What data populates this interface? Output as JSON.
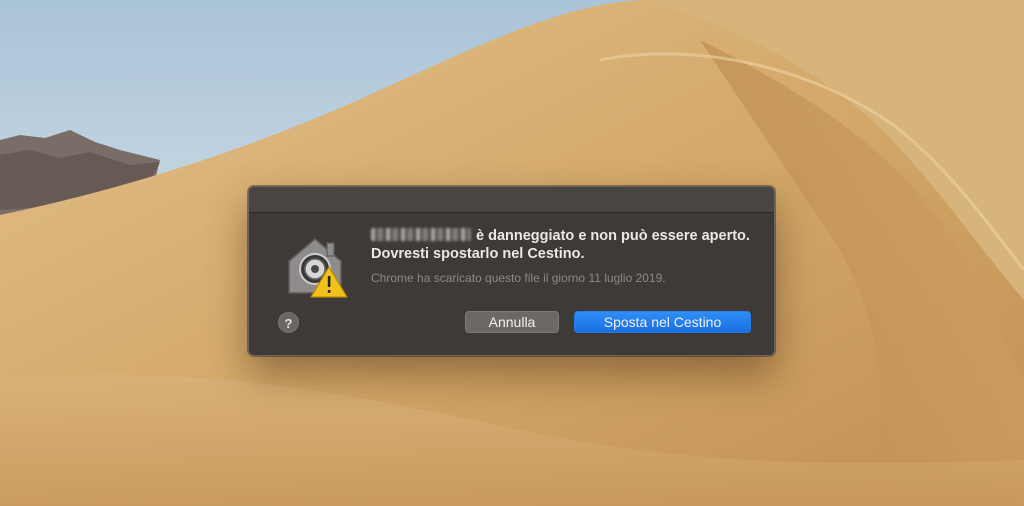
{
  "dialog": {
    "icon": "gatekeeper-warning-icon",
    "message_redacted_name": "",
    "message_text": "è danneggiato e non può essere aperto. Dovresti spostarlo nel Cestino.",
    "info_text": "Chrome ha scaricato questo file il giorno 11 luglio 2019.",
    "help_label": "?",
    "cancel_label": "Annulla",
    "move_to_trash_label": "Sposta nel Cestino"
  },
  "colors": {
    "accent": "#1b6fe0",
    "dialog_bg": "#3e3a37",
    "sand": "#d8b27a"
  }
}
